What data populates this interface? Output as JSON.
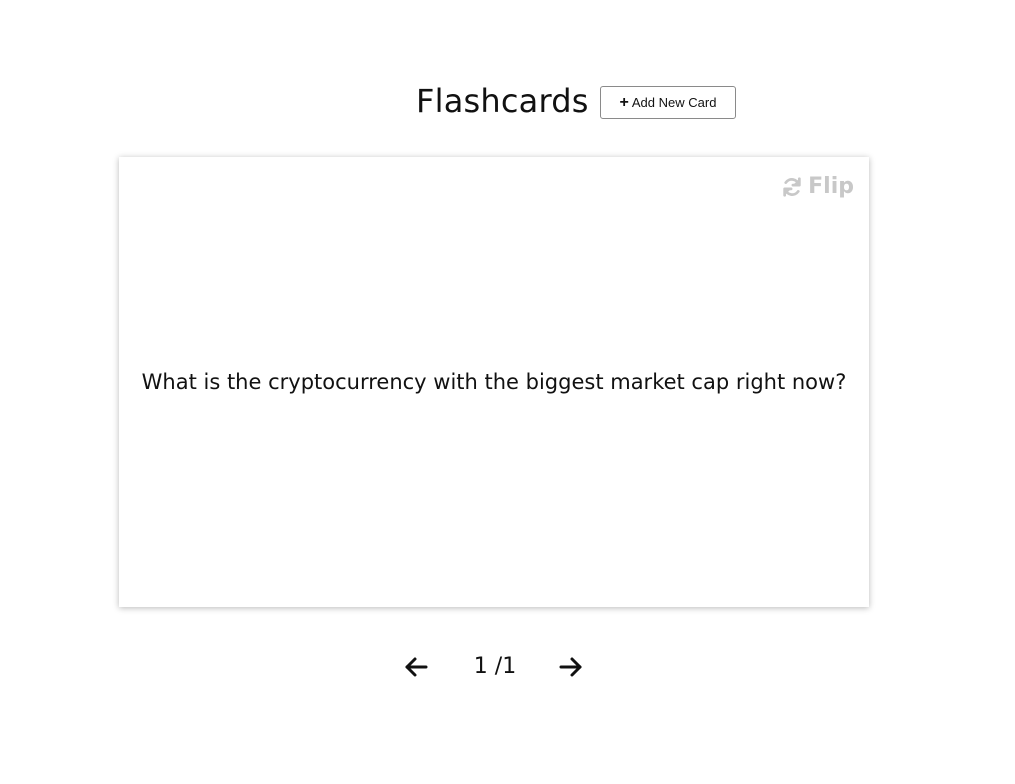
{
  "header": {
    "title": "Flashcards",
    "add_button_icon": "plus-icon",
    "add_button_label": "Add New Card"
  },
  "card": {
    "flip_icon": "refresh-icon",
    "flip_label": "Flip",
    "text": "What is the cryptocurrency with the biggest market cap right now?"
  },
  "navigation": {
    "prev_icon": "arrow-left-icon",
    "next_icon": "arrow-right-icon",
    "counter": "1 /1"
  },
  "colors": {
    "flip_text": "#c8c8c8",
    "text": "#111111",
    "button_border": "#8a8a8a"
  }
}
